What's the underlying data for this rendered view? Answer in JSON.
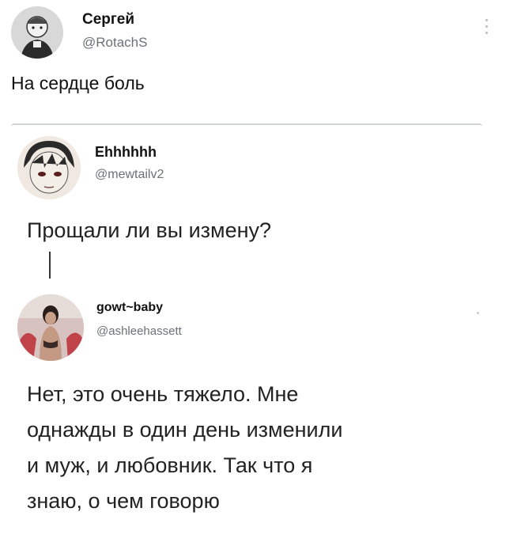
{
  "tweet": {
    "author_name": "Сергей",
    "author_handle": "@RotachS",
    "text": "На сердце боль"
  },
  "quote": {
    "author_name": "Ehhhhhh",
    "author_handle": "@mewtailv2",
    "text": "Прощали ли вы измену?"
  },
  "reply": {
    "author_name": "gowt~baby",
    "author_handle": "@ashleehassett",
    "lines": [
      "Нет, это очень тяжело. Мне",
      "однажды в один день изменили",
      "и муж, и любовник. Так что я",
      "знаю, о чем говорю"
    ]
  },
  "icons": {
    "more": "more-vertical-icon",
    "avatar_main": "avatar-illustration",
    "avatar_quote": "anime-avatar",
    "avatar_reply": "photo-avatar"
  }
}
